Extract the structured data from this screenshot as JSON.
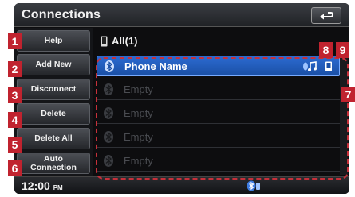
{
  "header": {
    "title": "Connections"
  },
  "sidebar": {
    "items": [
      {
        "label": "Help"
      },
      {
        "label": "Add New"
      },
      {
        "label": "Disconnect"
      },
      {
        "label": "Delete"
      },
      {
        "label": "Delete All"
      },
      {
        "label": "Auto\nConnection"
      }
    ]
  },
  "list": {
    "header_label": "All(1)",
    "rows": [
      {
        "name": "Phone Name",
        "state": "selected"
      },
      {
        "name": "Empty",
        "state": "empty"
      },
      {
        "name": "Empty",
        "state": "empty"
      },
      {
        "name": "Empty",
        "state": "empty"
      },
      {
        "name": "Empty",
        "state": "empty"
      }
    ]
  },
  "status": {
    "time": "12:00",
    "ampm": "PM"
  },
  "callouts": [
    "1",
    "2",
    "3",
    "4",
    "5",
    "6",
    "7",
    "8",
    "9"
  ],
  "colors": {
    "accent": "#2c6bd1",
    "callout": "#c0232f",
    "dash": "#c6303a"
  },
  "icons": [
    "back-arrow-icon",
    "phone-icon",
    "bluetooth-icon",
    "audio-streaming-icon",
    "phone-connected-icon",
    "bluetooth-status-icon"
  ]
}
